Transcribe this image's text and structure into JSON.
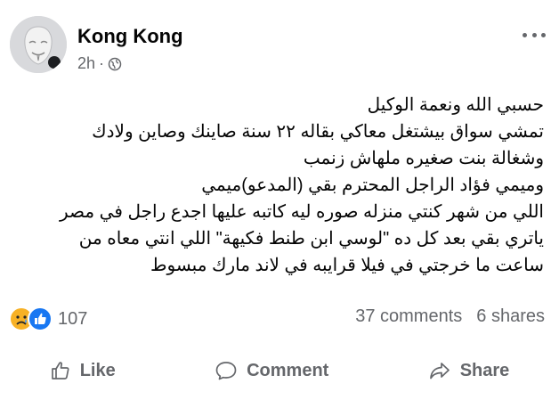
{
  "post": {
    "author": "Kong Kong",
    "time": "2h",
    "separator": "·",
    "privacy_icon": "globe-icon",
    "more_icon": "ellipsis-icon",
    "lines": [
      "حسبي الله  ونعمة الوكيل",
      "تمشي سواق بيشتغل معاكي بقاله ٢٢ سنة صاينك وصاين ولادك",
      "وشغالة بنت صغيره ملهاش زنمب",
      "وميمي فؤاد الراجل المحترم بقي (المدعو)ميمي",
      "اللي من شهر كنتي منزله صوره ليه كاتبه عليها اجدع راجل في مصر",
      "ياتري بقي بعد كل ده \"لوسي ابن طنط فكيهة\" اللي انتي معاه من",
      "ساعت ما خرجتي في فيلا قرايبه في لاند مارك مبسوط"
    ]
  },
  "reactions": {
    "icons": [
      "sad-reaction-icon",
      "like-reaction-icon"
    ],
    "count": "107"
  },
  "stats": {
    "comments": "37 comments",
    "shares": "6 shares"
  },
  "actions": {
    "like": "Like",
    "comment": "Comment",
    "share": "Share"
  },
  "colors": {
    "text": "#050505",
    "secondary": "#65676b",
    "like_blue": "#1877f2",
    "sad_yellow": "#f7b125"
  }
}
